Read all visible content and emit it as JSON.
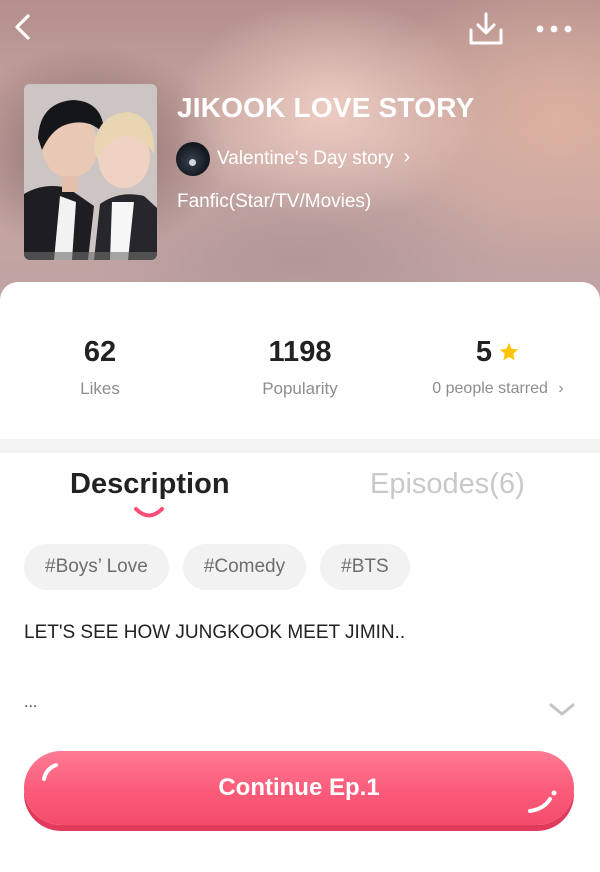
{
  "header": {
    "title": "JIKOOK LOVE STORY",
    "author": "Valentine's Day story",
    "category": "Fanfic(Star/TV/Movies)",
    "icons": [
      "back-icon",
      "download-icon",
      "more-icon",
      "chevron-right-icon"
    ]
  },
  "stats": {
    "likes": {
      "value": "62",
      "label": "Likes"
    },
    "popularity": {
      "value": "1198",
      "label": "Popularity"
    },
    "rating": {
      "value": "5",
      "label": "0 people starred",
      "icon": "star-icon"
    }
  },
  "tabs": [
    {
      "label": "Description",
      "active": true
    },
    {
      "label": "Episodes(6)",
      "active": false
    }
  ],
  "tags": [
    "#Boys’ Love",
    "#Comedy",
    "#BTS"
  ],
  "description": {
    "text": "LET'S SEE HOW JUNGKOOK MEET JIMIN..",
    "ellipsis": "..."
  },
  "continue_button": {
    "label": "Continue Ep.1"
  },
  "colors": {
    "accent": "#fb5b79",
    "star": "#ffc400",
    "text_primary": "#222222",
    "text_secondary": "#8d8d8d",
    "tag_bg": "#f2f2f2"
  }
}
